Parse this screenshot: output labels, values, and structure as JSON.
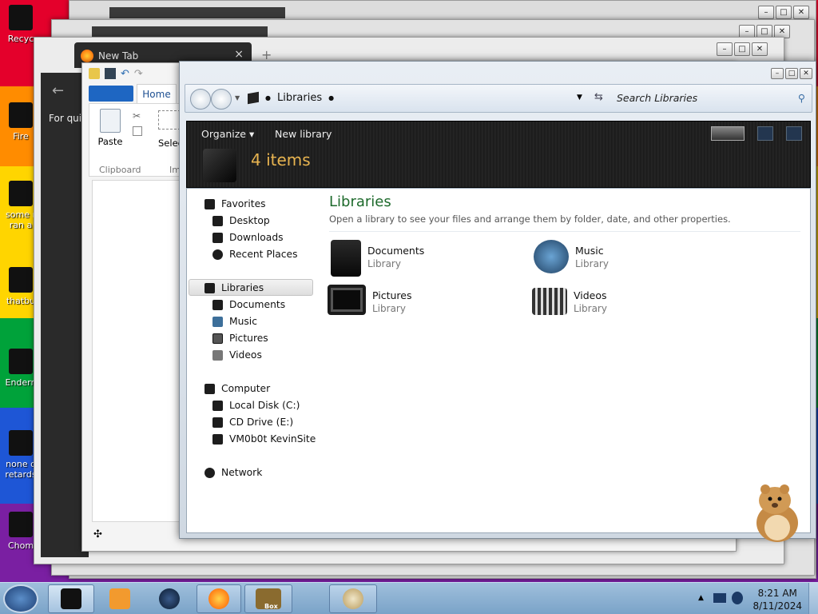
{
  "desktop": {
    "icons": [
      {
        "label": "Recyc"
      },
      {
        "label": "Fire"
      },
      {
        "label": "some r"
      },
      {
        "label": "ran a"
      },
      {
        "label": "thatbu"
      },
      {
        "label": "Endern"
      },
      {
        "label": "none o"
      },
      {
        "label": "retards"
      },
      {
        "label": "Chom"
      }
    ]
  },
  "browser": {
    "tab_title": "New Tab",
    "new_tab_symbol": "+",
    "close_symbol": "×",
    "side_text": "For quic"
  },
  "ribbon": {
    "home_tab": "Home",
    "paste_label": "Paste",
    "select_label": "Selec",
    "clipboard_group": "Clipboard",
    "im_group": "Im"
  },
  "explorer": {
    "breadcrumb": "Libraries",
    "search_placeholder": "Search Libraries",
    "toolbar": {
      "organize": "Organize ▾",
      "new_library": "New library",
      "item_count": "4 items"
    },
    "nav": {
      "favorites": "Favorites",
      "favorites_items": [
        "Desktop",
        "Downloads",
        "Recent Places"
      ],
      "libraries": "Libraries",
      "libraries_items": [
        "Documents",
        "Music",
        "Pictures",
        "Videos"
      ],
      "computer": "Computer",
      "computer_items": [
        "Local Disk (C:)",
        "CD Drive (E:)",
        "VM0b0t KevinSite"
      ],
      "network": "Network"
    },
    "content": {
      "title": "Libraries",
      "subtitle": "Open a library to see your files and arrange them by folder, date, and other properties.",
      "items": [
        {
          "name": "Documents",
          "kind": "Library"
        },
        {
          "name": "Music",
          "kind": "Library"
        },
        {
          "name": "Pictures",
          "kind": "Library"
        },
        {
          "name": "Videos",
          "kind": "Library"
        }
      ]
    }
  },
  "taskbar": {
    "time": "8:21 AM",
    "date": "8/11/2024",
    "box_label": "Box"
  },
  "colors": {
    "stripes": [
      "#e4002b",
      "#ff8c00",
      "#ffd500",
      "#00a23a",
      "#1e56d6",
      "#7a1fa2"
    ],
    "library_title": "#1e6a2c",
    "item_count": "#e8b450"
  }
}
